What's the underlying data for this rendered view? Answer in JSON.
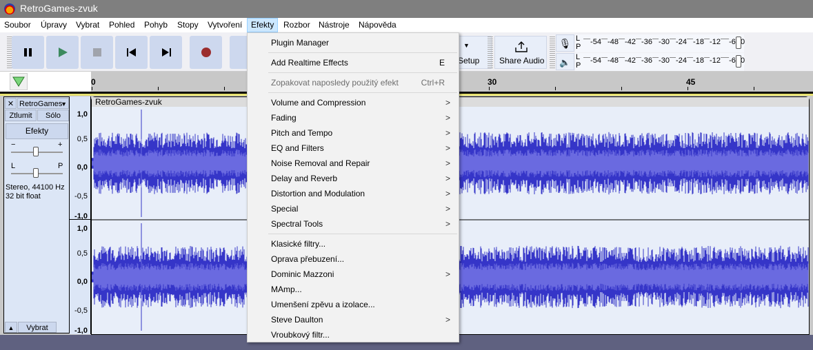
{
  "window": {
    "title": "RetroGames-zvuk"
  },
  "menubar": [
    {
      "label": "Soubor"
    },
    {
      "label": "Úpravy"
    },
    {
      "label": "Vybrat"
    },
    {
      "label": "Pohled"
    },
    {
      "label": "Pohyb"
    },
    {
      "label": "Stopy"
    },
    {
      "label": "Vytvoření"
    },
    {
      "label": "Efekty"
    },
    {
      "label": "Rozbor"
    },
    {
      "label": "Nástroje"
    },
    {
      "label": "Nápověda"
    }
  ],
  "toolbar": {
    "setup_label": "Setup",
    "share_label": "Share Audio",
    "meter_scale": [
      "-54",
      "-48",
      "-42",
      "-36",
      "-30",
      "-24",
      "-18",
      "-12",
      "-6",
      "0"
    ],
    "meter_lr": [
      "L",
      "P"
    ]
  },
  "timeline": {
    "labels": [
      "0",
      "30",
      "45"
    ]
  },
  "track": {
    "name": "RetroGames",
    "clip_name": "RetroGames-zvuk",
    "mute": "Ztlumit",
    "solo": "Sólo",
    "effects": "Efekty",
    "gain_min": "−",
    "gain_max": "+",
    "pan_left": "L",
    "pan_right": "P",
    "info1": "Stereo, 44100 Hz",
    "info2": "32 bit float",
    "select": "Vybrat",
    "y_labels": [
      "1,0",
      "0,5",
      "0,0",
      "-0,5",
      "-1,0"
    ]
  },
  "effects_menu": {
    "top": [
      {
        "label": "Plugin Manager",
        "shortcut": ""
      },
      {
        "label": "Add Realtime Effects",
        "shortcut": "E"
      },
      {
        "label": "Zopakovat naposledy použitý efekt",
        "shortcut": "Ctrl+R",
        "disabled": true
      }
    ],
    "categories": [
      "Volume and Compression",
      "Fading",
      "Pitch and Tempo",
      "EQ and Filters",
      "Noise Removal and Repair",
      "Delay and Reverb",
      "Distortion and Modulation",
      "Special",
      "Spectral Tools"
    ],
    "plugins": [
      {
        "label": "Klasické filtry...",
        "submenu": false
      },
      {
        "label": "Oprava přebuzení...",
        "submenu": false
      },
      {
        "label": "Dominic Mazzoni",
        "submenu": true
      },
      {
        "label": "MAmp...",
        "submenu": false
      },
      {
        "label": "Umenšení zpěvu a izolace...",
        "submenu": false
      },
      {
        "label": "Steve Daulton",
        "submenu": true
      },
      {
        "label": "Vroubkový filtr...",
        "submenu": false
      }
    ],
    "arrow": ">"
  },
  "colors": {
    "wave": "#3535c8",
    "wave_inner": "#6a6ae0",
    "accent": "#cce8ff"
  }
}
